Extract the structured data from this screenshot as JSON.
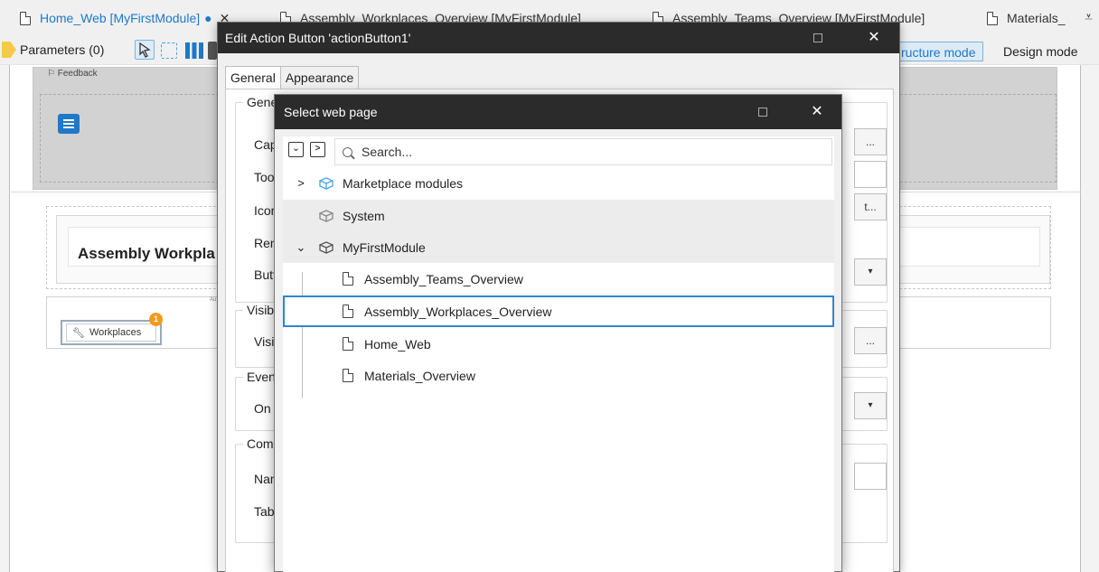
{
  "tabs": [
    {
      "label": "Home_Web [MyFirstModule]",
      "active": true,
      "dirty": "●",
      "close": "✕"
    },
    {
      "label": "Assembly_Workplaces_Overview [MyFirstModule]"
    },
    {
      "label": "Assembly_Teams_Overview [MyFirstModule]"
    },
    {
      "label": "Materials_"
    }
  ],
  "tab_overflow": "⩡",
  "toolbar": {
    "parameters_label": "Parameters (0)",
    "structure_mode": "ructure mode",
    "design_mode": "Design mode"
  },
  "canvas": {
    "feedback_label": "Feedback",
    "page_title": "Assembly Workpla",
    "small_label": "Au",
    "workplaces_button": "Workplaces",
    "badge_count": "1"
  },
  "edit_dialog": {
    "title": "Edit Action Button 'actionButton1'",
    "maximize": "□",
    "close": "✕",
    "tabs": [
      "General",
      "Appearance"
    ],
    "groups": [
      {
        "label": "Gene",
        "fields": [
          "Capti",
          "Toolt",
          "Icon",
          "Rend",
          "Butto"
        ]
      },
      {
        "label": "Visib",
        "fields": [
          "Visibl"
        ]
      },
      {
        "label": "Even",
        "fields": [
          "On cl"
        ]
      },
      {
        "label": "Com",
        "fields": [
          "Nam",
          "Tab ir"
        ]
      }
    ],
    "field_buttons": {
      "caption": "...",
      "icon": "t...",
      "button_style": "▾",
      "visible": "...",
      "on_click": "▾"
    }
  },
  "select_dialog": {
    "title": "Select web page",
    "maximize": "□",
    "close": "✕",
    "collapse_all": "⌄",
    "expand_all": ">",
    "search_placeholder": "Search...",
    "tree": [
      {
        "label": "Marketplace modules",
        "kind": "module",
        "expander": ">",
        "icon_color": "#4aa3df"
      },
      {
        "label": "System",
        "kind": "module",
        "expander": "",
        "icon_color": "#888888"
      },
      {
        "label": "MyFirstModule",
        "kind": "module",
        "expander": "⌄",
        "icon_color": "#555555"
      },
      {
        "label": "Assembly_Teams_Overview",
        "kind": "page"
      },
      {
        "label": "Assembly_Workplaces_Overview",
        "kind": "page",
        "selected": true
      },
      {
        "label": "Home_Web",
        "kind": "page"
      },
      {
        "label": "Materials_Overview",
        "kind": "page"
      }
    ]
  },
  "colors": {
    "accent": "#1f78c8",
    "titlebar": "#2b2b2b",
    "selection_border": "#2e86d0",
    "badge": "#f29a1b",
    "parameter_tag": "#f7c948"
  }
}
